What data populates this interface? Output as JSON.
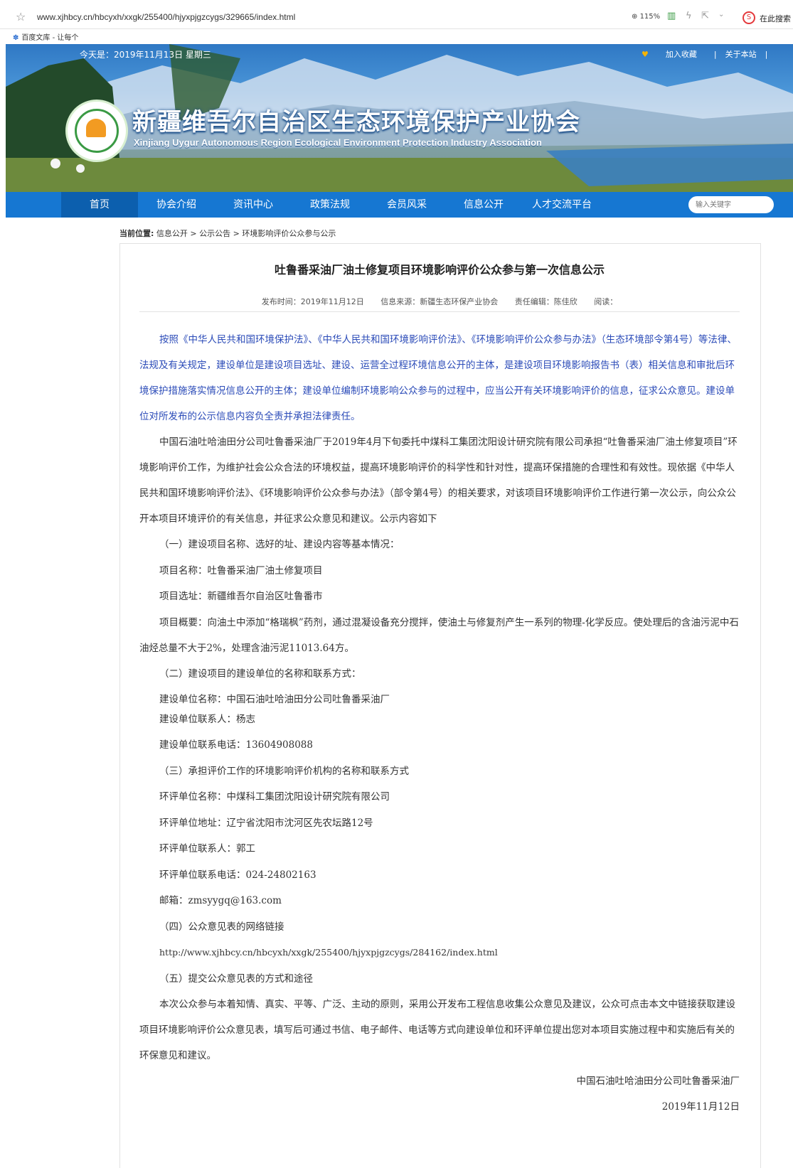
{
  "browser": {
    "url": "www.xjhbcy.cn/hbcyxh/xxgk/255400/hjyxpjgzcygs/329665/index.html",
    "zoom": "115%",
    "search_label": "在此搜索",
    "bookmark": "百度文库 - 让每个"
  },
  "banner": {
    "date": "今天是：2019年11月13日 星期三",
    "favorite": "加入收藏",
    "about": "关于本站",
    "title_cn": "新疆维吾尔自治区生态环境保护产业协会",
    "title_en": "Xinjiang Uygur Autonomous Region Ecological Environment Protection Industry Association"
  },
  "nav": {
    "items": [
      "首页",
      "协会介绍",
      "资讯中心",
      "政策法规",
      "会员风采",
      "信息公开",
      "人才交流平台"
    ],
    "search_placeholder": "输入关键字"
  },
  "breadcrumb": {
    "label": "当前位置:",
    "path": "信息公开 > 公示公告 > 环境影响评价公众参与公示"
  },
  "article": {
    "title": "吐鲁番采油厂油土修复项目环境影响评价公众参与第一次信息公示",
    "publish": "发布时间：2019年11月12日",
    "source": "信息来源：新疆生态环保产业协会",
    "editor": "责任编辑：陈佳欣",
    "read": "阅读：",
    "p1": "按照《中华人民共和国环境保护法》、《中华人民共和国环境影响评价法》、《环境影响评价公众参与办法》（生态环境部令第4号）等法律、法规及有关规定，建设单位是建设项目选址、建设、运营全过程环境信息公开的主体，是建设项目环境影响报告书（表）相关信息和审批后环境保护措施落实情况信息公开的主体；建设单位编制环境影响公众参与的过程中，应当公开有关环境影响评价的信息，征求公众意见。建设单位对所发布的公示信息内容负全责并承担法律责任。",
    "p2": "中国石油吐哈油田分公司吐鲁番采油厂于2019年4月下旬委托中煤科工集团沈阳设计研究院有限公司承担“吐鲁番采油厂油土修复项目”环境影响评价工作，为维护社会公众合法的环境权益，提高环境影响评价的科学性和针对性，提高环保措施的合理性和有效性。现依据《中华人民共和国环境影响评价法》、《环境影响评价公众参与办法》（部令第4号）的相关要求，对该项目环境影响评价工作进行第一次公示，向公众公开本项目环境评价的有关信息，并征求公众意见和建议。公示内容如下",
    "s1": "（一）建设项目名称、选好的址、建设内容等基本情况：",
    "name": "项目名称：吐鲁番采油厂油土修复项目",
    "site": "项目选址：新疆维吾尔自治区吐鲁番市",
    "overview": "项目概要：向油土中添加“格瑞枫”药剂，通过混凝设备充分搅拌，使油土与修复剂产生一系列的物理-化学反应。使处理后的含油污泥中石油烃总量不大于2%，处理含油污泥11013.64方。",
    "s2": "（二）建设项目的建设单位的名称和联系方式：",
    "unit": "建设单位名称：中国石油吐哈油田分公司吐鲁番采油厂",
    "contact": "建设单位联系人：杨志",
    "phone": "建设单位联系电话：13604908088",
    "s3": "（三）承担评价工作的环境影响评价机构的名称和联系方式",
    "eia_name": "环评单位名称：中煤科工集团沈阳设计研究院有限公司",
    "eia_addr": "环评单位地址：辽宁省沈阳市沈河区先农坛路12号",
    "eia_contact": "环评单位联系人：郭工",
    "eia_phone": "环评单位联系电话：024-24802163",
    "email": "邮箱：zmsyygq@163.com",
    "s4": "（四）公众意见表的网络链接",
    "link": "http://www.xjhbcy.cn/hbcyxh/xxgk/255400/hjyxpjgzcygs/284162/index.html",
    "s5": "（五）提交公众意见表的方式和途径",
    "p5": "本次公众参与本着知情、真实、平等、广泛、主动的原则，采用公开发布工程信息收集公众意见及建议，公众可点击本文中链接获取建设项目环境影响评价公众意见表，填写后可通过书信、电子邮件、电话等方式向建设单位和环评单位提出您对本项目实施过程中和实施后有关的环保意见和建议。",
    "sign": "中国石油吐哈油田分公司吐鲁番采油厂",
    "sign_date": "2019年11月12日"
  }
}
